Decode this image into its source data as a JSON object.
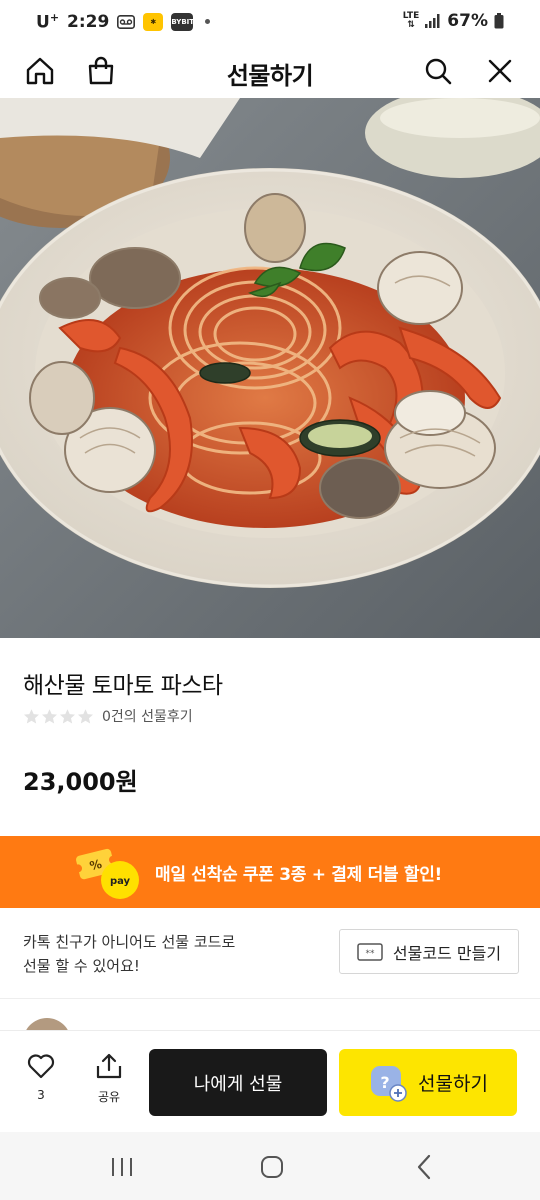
{
  "status_bar": {
    "carrier": "U",
    "carrier_sup": "+",
    "time": "2:29",
    "network": "LTE",
    "battery": "67%",
    "app_icon_label": "BYBIT"
  },
  "header": {
    "title": "선물하기",
    "icons": [
      "home-icon",
      "shopping-bag-icon",
      "search-icon",
      "close-icon"
    ]
  },
  "product": {
    "name": "해산물 토마토 파스타",
    "rating_stars": 0,
    "rating_max": 5,
    "review_count_text": "0건의 선물후기",
    "price": "23,000원"
  },
  "promo": {
    "text": "매일 선착순 쿠폰 3종 + 결제 더블 할인!",
    "badge": "pay",
    "color": "#ff7a12"
  },
  "gift_code": {
    "description_line1": "카톡 친구가 아니어도 선물 코드로",
    "description_line2": "선물 할 수 있어요!",
    "button_label": "선물코드 만들기"
  },
  "actions": {
    "like_count": "3",
    "share_label": "공유",
    "gift_self_label": "나에게 선물",
    "gift_label": "선물하기",
    "accent": "#fde500"
  },
  "nav": {
    "icons": [
      "recent-apps-icon",
      "home-circle-icon",
      "back-icon"
    ]
  }
}
